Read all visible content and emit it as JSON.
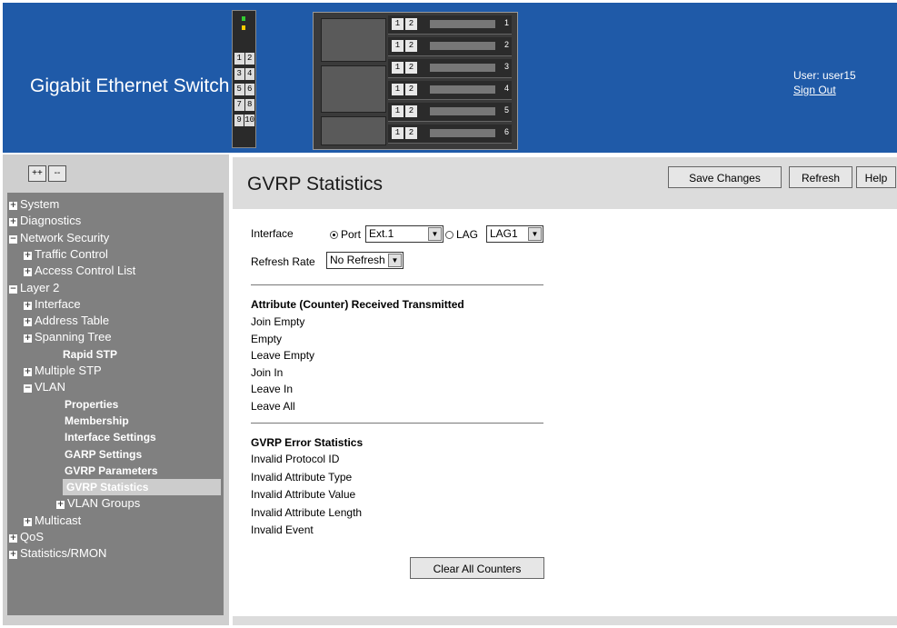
{
  "header": {
    "title": "Gigabit Ethernet Switch",
    "user_label": "User: user15",
    "sign_out": "Sign Out",
    "background_color": "#1f5aa8",
    "small_switch_ports": [
      "1",
      "2",
      "3",
      "4",
      "5",
      "6",
      "7",
      "8",
      "9",
      "10"
    ],
    "chassis_blades": [
      "1",
      "2",
      "3",
      "4",
      "5",
      "6"
    ]
  },
  "tree_controls": {
    "expand_all": "++",
    "collapse_all": "--"
  },
  "nav_tree": [
    {
      "label": "System",
      "toggle": "+"
    },
    {
      "label": "Diagnostics",
      "toggle": "+"
    },
    {
      "label": "Network Security",
      "toggle": "−"
    },
    {
      "label": "Traffic Control",
      "toggle": "+"
    },
    {
      "label": "Access Control List",
      "toggle": "+"
    },
    {
      "label": "Layer 2",
      "toggle": "−"
    },
    {
      "label": "Interface",
      "toggle": "+"
    },
    {
      "label": "Address Table",
      "toggle": "+"
    },
    {
      "label": "Spanning Tree",
      "toggle": "+"
    },
    {
      "label": "Rapid STP",
      "toggle": ""
    },
    {
      "label": "Multiple STP",
      "toggle": "+"
    },
    {
      "label": "VLAN",
      "toggle": "−"
    },
    {
      "label": "Properties",
      "toggle": ""
    },
    {
      "label": "Membership",
      "toggle": ""
    },
    {
      "label": "Interface Settings",
      "toggle": ""
    },
    {
      "label": "GARP Settings",
      "toggle": ""
    },
    {
      "label": "GVRP Parameters",
      "toggle": ""
    },
    {
      "label": "GVRP Statistics",
      "toggle": "",
      "selected": true
    },
    {
      "label": "VLAN Groups",
      "toggle": "+"
    },
    {
      "label": "Multicast",
      "toggle": "+"
    },
    {
      "label": "QoS",
      "toggle": "+"
    },
    {
      "label": "Statistics/RMON",
      "toggle": "+"
    }
  ],
  "page": {
    "title": "GVRP Statistics",
    "buttons": {
      "save": "Save Changes",
      "refresh": "Refresh",
      "help": "Help"
    }
  },
  "form": {
    "interface_label": "Interface",
    "port_label": "Port",
    "port_value": "Ext.1",
    "lag_label": "LAG",
    "lag_value": "LAG1",
    "selected_interface": "Port",
    "refresh_rate_label": "Refresh Rate",
    "refresh_rate_value": "No Refresh"
  },
  "attributes": {
    "header": "Attribute (Counter) Received Transmitted",
    "rows": [
      "Join Empty",
      "Empty",
      "Leave Empty",
      "Join In",
      "Leave In",
      "Leave All"
    ]
  },
  "errors": {
    "header": "GVRP Error Statistics",
    "rows": [
      "Invalid Protocol ID",
      "Invalid Attribute Type",
      "Invalid Attribute Value",
      "Invalid Attribute Length",
      "Invalid Event"
    ]
  },
  "clear_button": "Clear All Counters"
}
